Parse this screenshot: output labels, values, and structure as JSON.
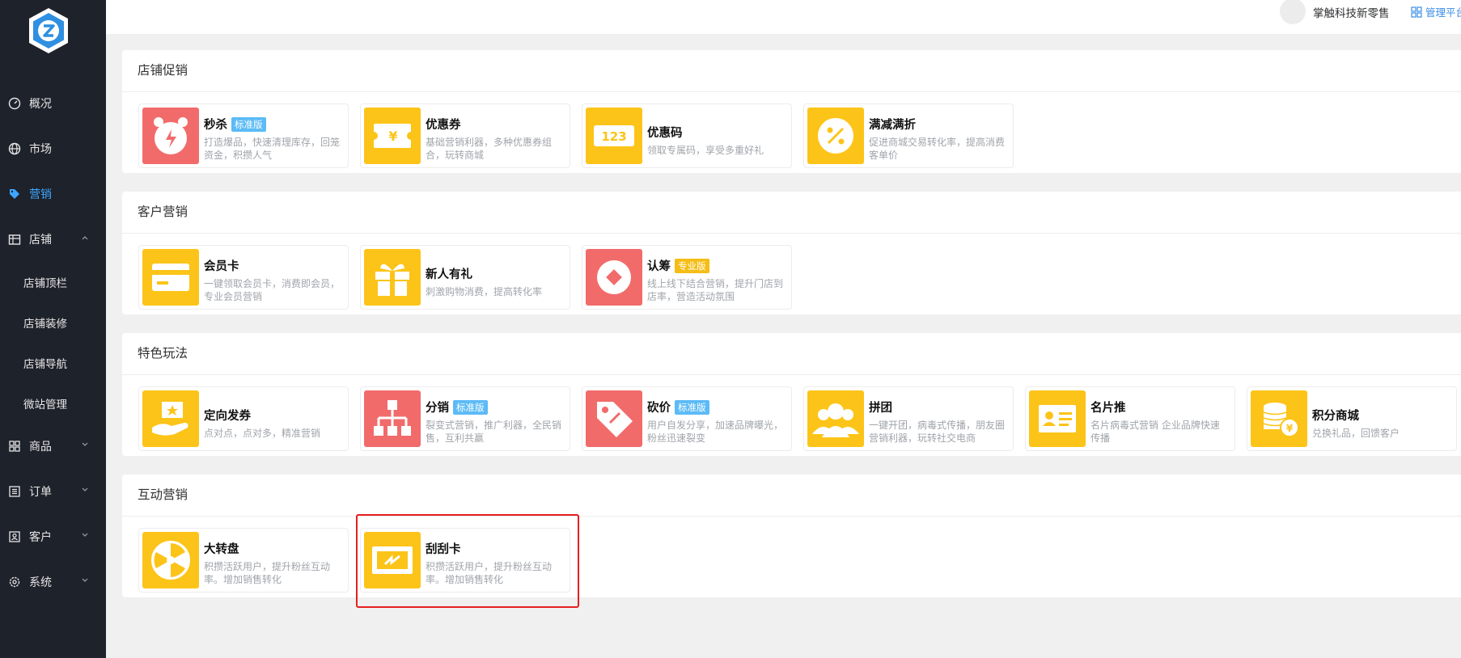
{
  "header": {
    "company": "掌触科技新零售",
    "admin_link": "管理平台"
  },
  "sidebar": {
    "items": [
      {
        "label": "概况",
        "icon": "dashboard-icon"
      },
      {
        "label": "市场",
        "icon": "globe-icon"
      },
      {
        "label": "营销",
        "icon": "tag-icon",
        "active": true
      },
      {
        "label": "店铺",
        "icon": "store-icon",
        "expanded": true
      }
    ],
    "sub_items": [
      "店铺顶栏",
      "店铺装修",
      "店铺导航",
      "微站管理"
    ],
    "items_after": [
      {
        "label": "商品",
        "icon": "grid-icon"
      },
      {
        "label": "订单",
        "icon": "list-icon"
      },
      {
        "label": "客户",
        "icon": "user-icon"
      },
      {
        "label": "系统",
        "icon": "gear-icon"
      }
    ]
  },
  "sections": [
    {
      "title": "店铺促销",
      "cards": [
        {
          "name": "秒杀",
          "badge": "标准版",
          "badge_color": "blue",
          "desc": "打造爆品，快速清理库存，回笼资金，积攒人气",
          "icon": "alarm-clock-icon",
          "color": "#f26b6b"
        },
        {
          "name": "优惠券",
          "desc": "基础营销利器，多种优惠券组合，玩转商城",
          "icon": "coupon-icon",
          "color": "#fcc419"
        },
        {
          "name": "优惠码",
          "desc": "领取专属码，享受多重好礼",
          "icon": "code-123-icon",
          "color": "#fcc419"
        },
        {
          "name": "满减满折",
          "desc": "促进商城交易转化率，提高消费客单价",
          "icon": "percent-badge-icon",
          "color": "#fcc419"
        }
      ]
    },
    {
      "title": "客户营销",
      "cards": [
        {
          "name": "会员卡",
          "desc": "一键领取会员卡，消费即会员，专业会员营销",
          "icon": "member-card-icon",
          "color": "#fcc419"
        },
        {
          "name": "新人有礼",
          "desc": "刺激购物消费，提高转化率",
          "icon": "gift-icon",
          "color": "#fcc419"
        },
        {
          "name": "认筹",
          "badge": "专业版",
          "badge_color": "yellow",
          "desc": "线上线下结合营销，提升门店到店率，营造活动氛围",
          "icon": "diamond-coin-icon",
          "color": "#f26b6b"
        }
      ]
    },
    {
      "title": "特色玩法",
      "cards": [
        {
          "name": "定向发券",
          "desc": "点对点，点对多，精准营销",
          "icon": "hand-coupon-icon",
          "color": "#fcc419"
        },
        {
          "name": "分销",
          "badge": "标准版",
          "badge_color": "blue",
          "desc": "裂变式营销，推广利器，全民销售，互利共赢",
          "icon": "hierarchy-icon",
          "color": "#f26b6b"
        },
        {
          "name": "砍价",
          "badge": "标准版",
          "badge_color": "blue",
          "desc": "用户自发分享，加速品牌曝光，粉丝迅速裂变",
          "icon": "price-tag-icon",
          "color": "#f26b6b"
        },
        {
          "name": "拼团",
          "desc": "一键开团，病毒式传播，朋友圈营销利器，玩转社交电商",
          "icon": "group-icon",
          "color": "#fcc419"
        },
        {
          "name": "名片推",
          "desc": "名片病毒式营销 企业品牌快速传播",
          "icon": "business-card-icon",
          "color": "#fcc419"
        },
        {
          "name": "积分商城",
          "desc": "兑换礼品，回馈客户",
          "icon": "coins-icon",
          "color": "#fcc419"
        }
      ]
    },
    {
      "title": "互动营销",
      "cards": [
        {
          "name": "大转盘",
          "desc": "积攒活跃用户，提升粉丝互动率。增加销售转化",
          "icon": "wheel-icon",
          "color": "#fcc419"
        },
        {
          "name": "刮刮卡",
          "desc": "积攒活跃用户，提升粉丝互动率。增加销售转化",
          "icon": "scratch-card-icon",
          "color": "#fcc419"
        }
      ]
    }
  ]
}
